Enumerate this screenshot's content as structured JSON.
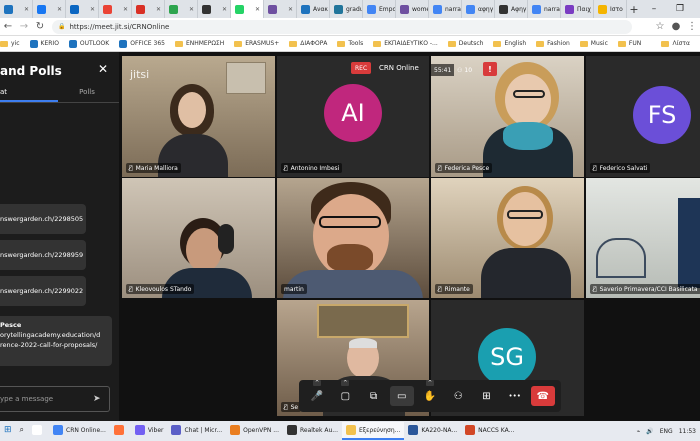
{
  "browser": {
    "tabs": [
      {
        "label": "",
        "color": "#1e73be"
      },
      {
        "label": "",
        "color": "#1877f2"
      },
      {
        "label": "",
        "color": "#0a66c2"
      },
      {
        "label": "",
        "color": "#ea4335"
      },
      {
        "label": "",
        "color": "#d93025"
      },
      {
        "label": "",
        "color": "#2da44e"
      },
      {
        "label": "",
        "color": "#333333"
      },
      {
        "label": "",
        "color": "#25d366"
      },
      {
        "label": "",
        "color": "#6e4fa0"
      },
      {
        "label": "Ανακ",
        "color": "#1e73be"
      },
      {
        "label": "gradu",
        "color": "#21759b"
      },
      {
        "label": "Empo",
        "color": "#4285f4"
      },
      {
        "label": "wome",
        "color": "#6e4fa0"
      },
      {
        "label": "narrat",
        "color": "#4285f4"
      },
      {
        "label": "αφηγ",
        "color": "#4285f4"
      },
      {
        "label": "Αφηγ",
        "color": "#333333"
      },
      {
        "label": "narra",
        "color": "#4285f4"
      },
      {
        "label": "Παιχ",
        "color": "#7a3cc2"
      },
      {
        "label": "Ιστο",
        "color": "#f4b400"
      }
    ],
    "active_tab_index": 7,
    "new_tab": "+",
    "window_controls": [
      "–",
      "❐",
      "✕"
    ],
    "url": "https://meet.jit.si/CRNOnline",
    "bookmarks": [
      {
        "label": "yic",
        "kind": "folder"
      },
      {
        "label": "KERIO",
        "kind": "site"
      },
      {
        "label": "OUTLOOK",
        "kind": "site"
      },
      {
        "label": "OFFICE 365",
        "kind": "site"
      },
      {
        "label": "ΕΝΗΜΕΡΩΣΗ",
        "kind": "folder"
      },
      {
        "label": "ERASMUS+",
        "kind": "folder"
      },
      {
        "label": "ΔΙΑΦΟΡΑ",
        "kind": "folder"
      },
      {
        "label": "Tools",
        "kind": "folder"
      },
      {
        "label": "ΕΚΠΑΙΔΕΥΤΙΚΟ -...",
        "kind": "folder"
      },
      {
        "label": "Deutsch",
        "kind": "folder"
      },
      {
        "label": "English",
        "kind": "folder"
      },
      {
        "label": "Fashion",
        "kind": "folder"
      },
      {
        "label": "Music",
        "kind": "folder"
      },
      {
        "label": "FUN",
        "kind": "folder"
      }
    ],
    "bookmarks_more": "Λίστα"
  },
  "chat": {
    "title": "and Polls",
    "close": "✕",
    "tab_chat": "at",
    "tab_polls": "Polls",
    "messages": [
      "nswergarden.ch/2298505",
      "nswergarden.ch/2298959",
      "nswergarden.ch/2299022"
    ],
    "last_message": {
      "sender": "Pesce",
      "lines": [
        "orytellingacademy.education/d",
        "rence-2022-call-for-proposals/"
      ]
    },
    "input_placeholder": "ype a message",
    "send_icon": "➤"
  },
  "meeting": {
    "jitsi_logo": "jitsi",
    "rec_badge": "REC",
    "room_name": "CRN Online",
    "timer": "55:41",
    "participant_count": "10",
    "warning_icon": "!",
    "selected_tile": "martin",
    "participants": [
      {
        "name": "Maria Malliora",
        "avatar": "",
        "muted": true
      },
      {
        "name": "Antonino Imbesi",
        "avatar": "AI",
        "muted": true
      },
      {
        "name": "Federica Pesce",
        "avatar": "",
        "muted": true
      },
      {
        "name": "Federico Salvati",
        "avatar": "FS",
        "muted": true
      },
      {
        "name": "Kleovoulos STando",
        "avatar": "",
        "muted": true
      },
      {
        "name": "martin",
        "avatar": "",
        "muted": false
      },
      {
        "name": "Rimante",
        "avatar": "",
        "muted": true
      },
      {
        "name": "Saverio Primavera/CCI Basilicata",
        "avatar": "",
        "muted": true
      },
      {
        "name": "Se",
        "avatar": "",
        "muted": true
      },
      {
        "name": "",
        "avatar": "SG",
        "muted": false
      }
    ],
    "toolbar": {
      "mic": "🎤",
      "camera": "▢",
      "share": "⧉",
      "chat": "▭",
      "raise_hand": "✋",
      "participants": "⚇",
      "tile_view": "⊞",
      "more": "•••",
      "hangup": "☎"
    }
  },
  "taskbar": {
    "items": [
      {
        "label": "",
        "color": "#ffffff"
      },
      {
        "label": "CRN Online...",
        "color": "#4285f4"
      },
      {
        "label": "",
        "color": "#ff7139"
      },
      {
        "label": "Viber",
        "color": "#7360f2"
      },
      {
        "label": "Chat | Micr...",
        "color": "#5b5fc7"
      },
      {
        "label": "OpenVPN ...",
        "color": "#ea7e20"
      },
      {
        "label": "Realtek Au...",
        "color": "#333333"
      },
      {
        "label": "Εξερεύνηση...",
        "color": "#f2c14e"
      },
      {
        "label": "KA220-NA...",
        "color": "#2b579a"
      },
      {
        "label": "NACCS KA...",
        "color": "#d24726"
      }
    ],
    "active_index": 7,
    "lang": "ENG",
    "time": "11:53"
  },
  "colors": {
    "accent": "#3d7ef0",
    "avatar_ai": "#c0277d",
    "avatar_fs": "#6b4fd8",
    "avatar_sg": "#1a9fb0",
    "rec_red": "#d83b3b"
  }
}
